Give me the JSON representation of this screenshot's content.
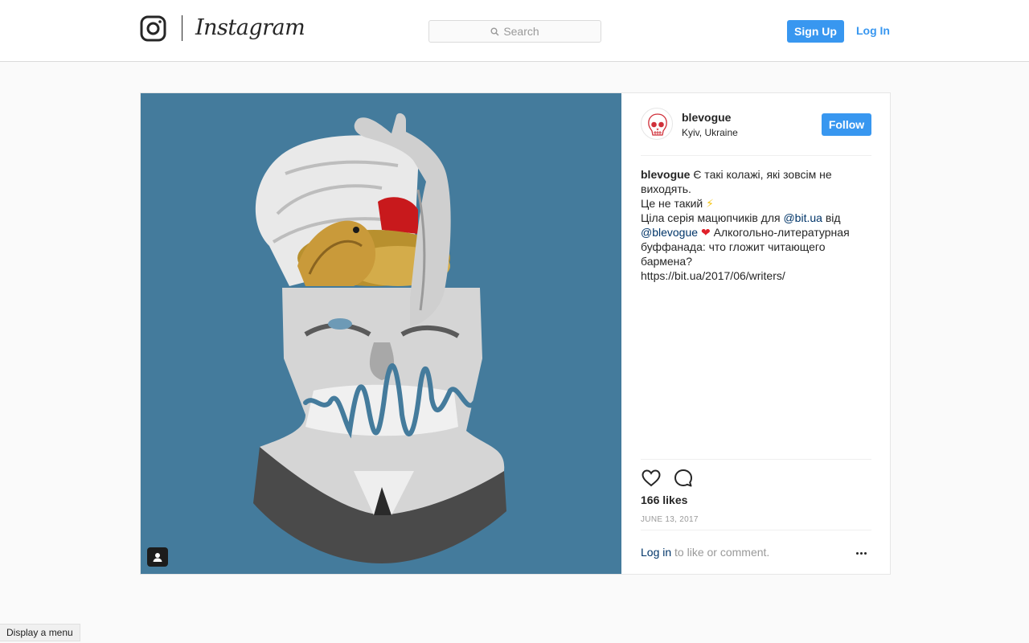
{
  "header": {
    "wordmark": "Instagram",
    "search_placeholder": "Search",
    "signup_label": "Sign Up",
    "login_label": "Log In"
  },
  "post": {
    "author": {
      "username": "blevogue",
      "location": "Kyiv, Ukraine",
      "follow_label": "Follow"
    },
    "caption": {
      "username": "blevogue",
      "line1": "Є такі колажі, які зовсім не виходять.",
      "line2": "Це не такий",
      "line3_prefix": "Ціла серія мацюпчиків для",
      "mention1": "@bit.ua",
      "line3_suffix": "від",
      "mention2": "@blevogue",
      "line4": "Алкогольно-литературная буффанада: что гложит читающего бармена?",
      "link": "https://bit.ua/2017/06/writers/",
      "emoji_bolt": "⚡",
      "emoji_heart": "❤"
    },
    "likes": "166 likes",
    "date": "JUNE 13, 2017",
    "comment_prompt": {
      "login_link": "Log in",
      "suffix": " to like or comment."
    },
    "icons": {
      "like": "heart-icon",
      "comment": "comment-bubble-icon",
      "more": "more-options-icon",
      "user_tag": "user-tag-icon"
    }
  },
  "tooltip": "Display a menu",
  "colors": {
    "accent": "#3897f0",
    "media_background": "#447b9c",
    "link": "#003569"
  }
}
